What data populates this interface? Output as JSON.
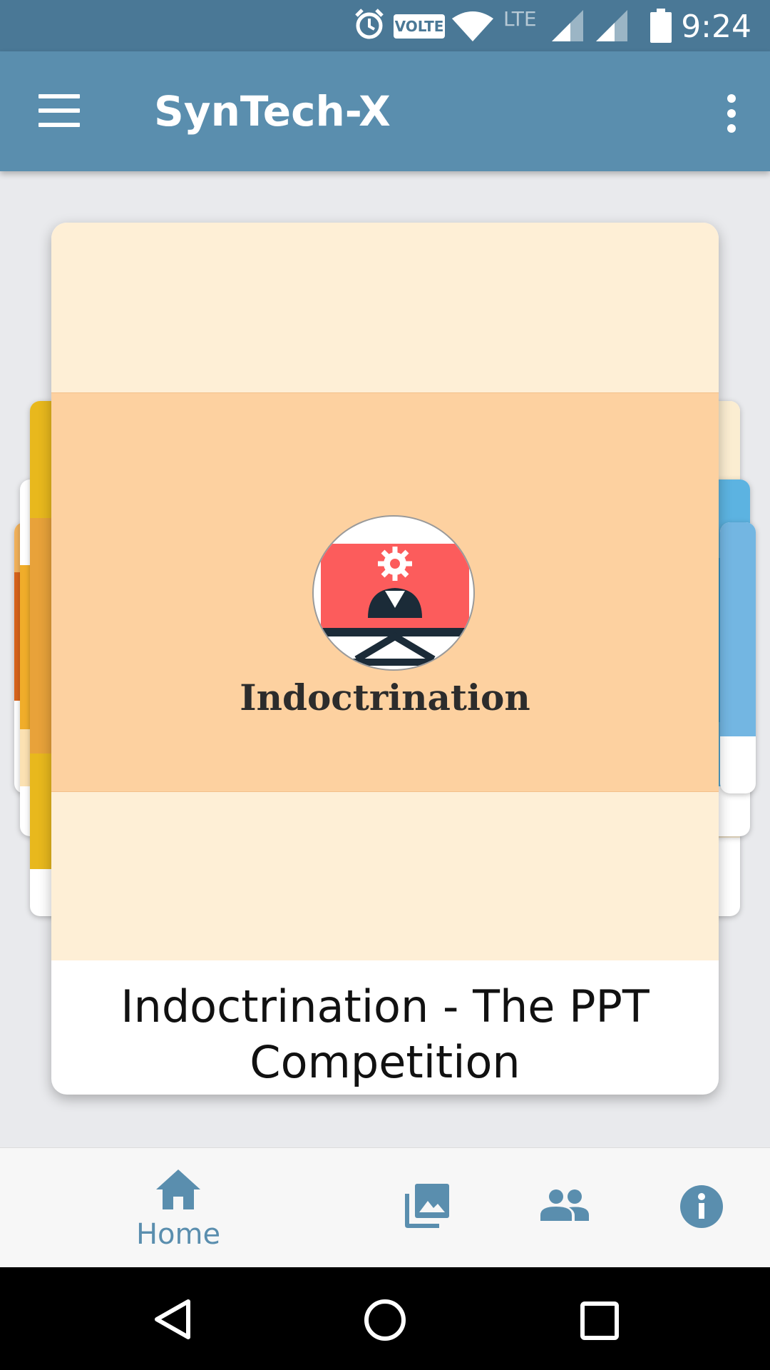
{
  "status_bar": {
    "time": "9:24",
    "volte": "VOLTE",
    "lte": "LTE",
    "icons": [
      "alarm-icon",
      "volte-icon",
      "wifi-icon",
      "lte-icon",
      "signal-icon",
      "signal-icon",
      "battery-icon"
    ]
  },
  "app_bar": {
    "title": "SynTech-X",
    "menu_icon": "hamburger-menu-icon",
    "overflow_icon": "more-vert-icon"
  },
  "carousel": {
    "active_card": {
      "poster_title": "Indoctrination",
      "caption": "Indoctrination - The PPT Competition"
    }
  },
  "bottom_nav": {
    "items": [
      {
        "label": "Home",
        "icon": "home-icon",
        "active": true
      },
      {
        "label": "",
        "icon": "gallery-icon",
        "active": false
      },
      {
        "label": "",
        "icon": "people-icon",
        "active": false
      },
      {
        "label": "",
        "icon": "info-icon",
        "active": false
      }
    ]
  },
  "colors": {
    "status_bar": "#4a7896",
    "app_bar": "#5a8eae",
    "accent": "#5a8eae",
    "poster_background": "#feefd6",
    "poster_band": "#fdd1a0",
    "logo_screen": "#fc5c5c"
  }
}
